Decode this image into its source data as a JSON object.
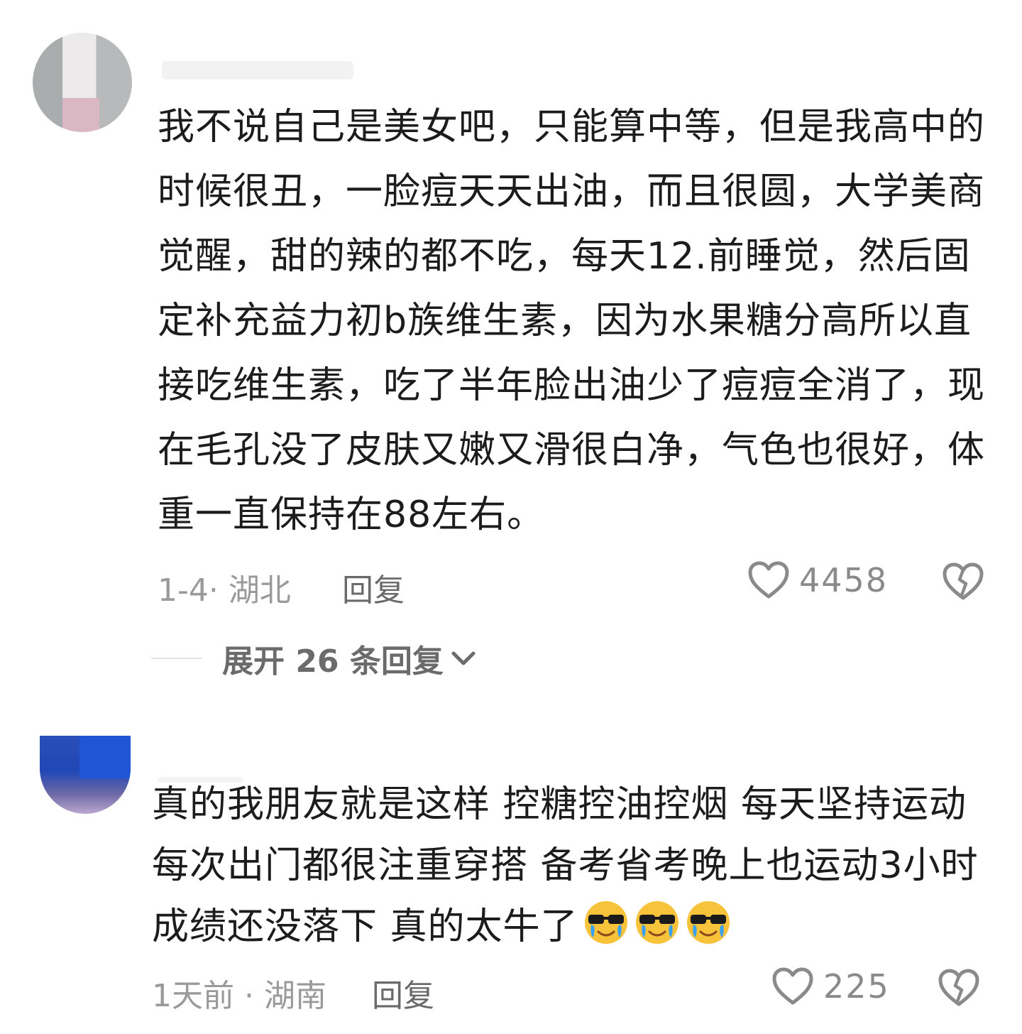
{
  "comments": [
    {
      "text": "我不说自己是美女吧，只能算中等，但是我高中的时候很丑，一脸痘天天出油，而且很圆，大学美商觉醒，甜的辣的都不吃，每天12.前睡觉，然后固定补充益力初b族维生素，因为水果糖分高所以直接吃维生素，吃了半年脸出油少了痘痘全消了，现在毛孔没了皮肤又嫩又滑很白净，气色也很好，体重一直保持在88左右。",
      "meta": "1-4· 湖北",
      "reply_label": "回复",
      "likes": "4458",
      "expand_label": "展开 26 条回复"
    },
    {
      "text": "真的我朋友就是这样  控糖控油控烟  每天坚持运动 每次出门都很注重穿搭 备考省考晚上也运动3小时 成绩还没落下  真的太牛了",
      "meta": "1天前 · 湖南",
      "reply_label": "回复",
      "likes": "225",
      "emojis": [
        "sunglasses-crying-emoji",
        "sunglasses-crying-emoji",
        "sunglasses-crying-emoji"
      ]
    }
  ],
  "icons": {
    "like": "heart-outline-icon",
    "dislike": "broken-heart-icon",
    "expand": "chevron-down-icon"
  },
  "colors": {
    "text": "#1c1c1c",
    "meta": "#9a9a9a",
    "reply": "#6a6a6a",
    "icon": "#8a8a8a"
  }
}
